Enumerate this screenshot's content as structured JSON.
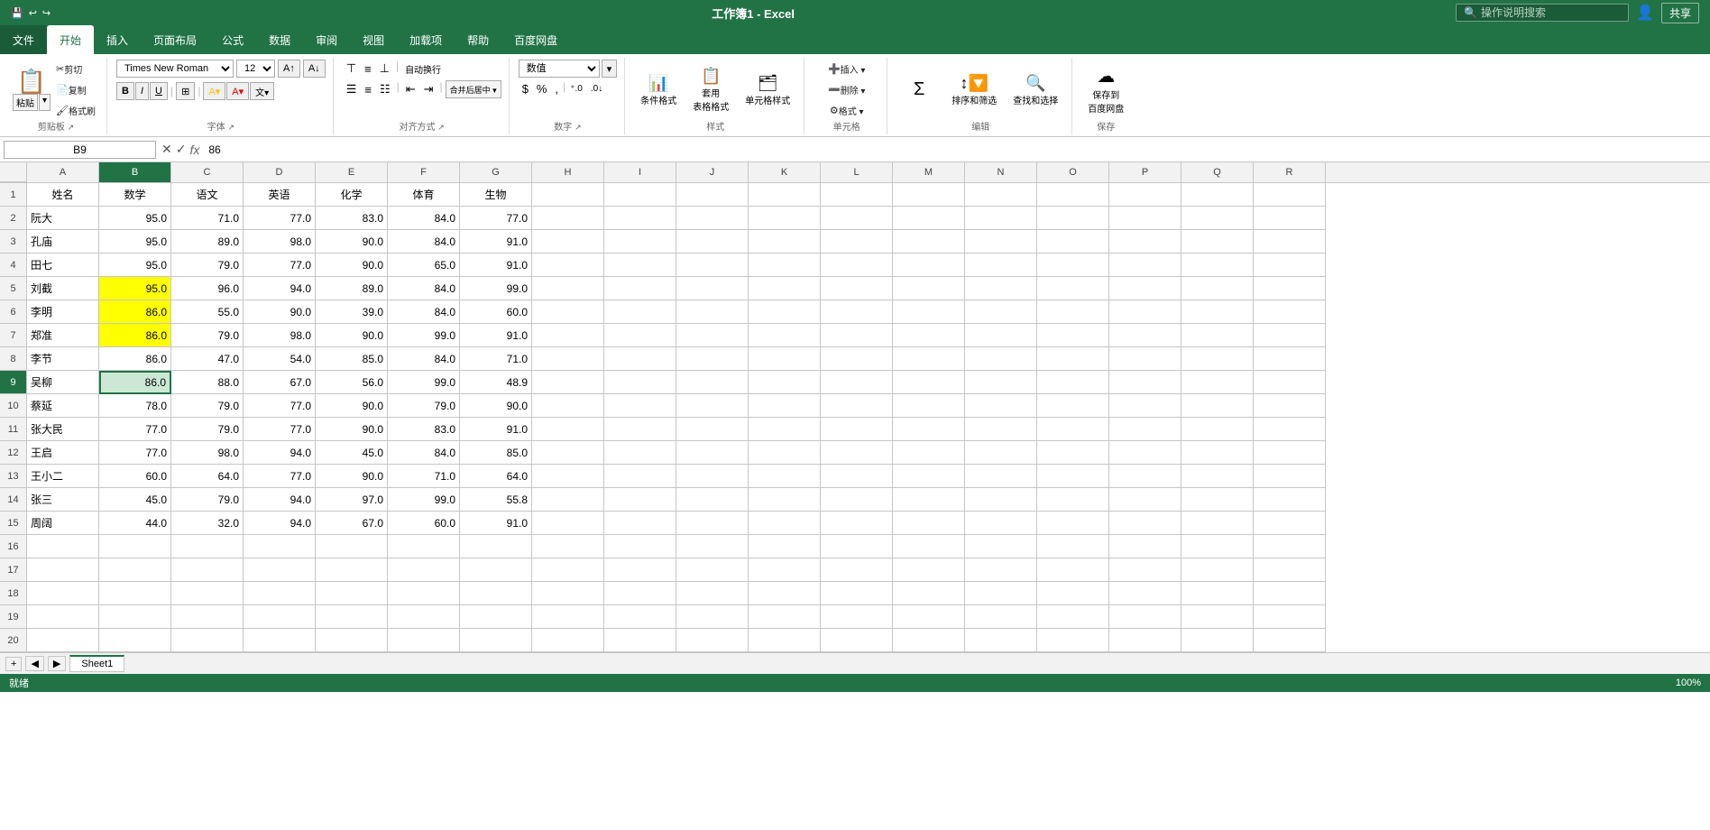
{
  "titleBar": {
    "filename": "工作簿1 - Excel",
    "shareBtn": "共享",
    "userIcon": "👤"
  },
  "ribbon": {
    "tabs": [
      "文件",
      "开始",
      "插入",
      "页面布局",
      "公式",
      "数据",
      "审阅",
      "视图",
      "加载项",
      "帮助",
      "百度网盘"
    ],
    "activeTab": "开始",
    "searchPlaceholder": "操作说明搜索",
    "clipboard": {
      "label": "剪贴板",
      "paste": "粘贴",
      "cut": "✂",
      "copy": "📋",
      "formatPainter": "🖌"
    },
    "font": {
      "label": "字体",
      "fontName": "Times New Roman",
      "fontSize": "12",
      "boldLabel": "B",
      "italicLabel": "I",
      "underlineLabel": "U",
      "increaseFontLabel": "A↑",
      "decreaseFontLabel": "A↓",
      "borderLabel": "⊞",
      "fillLabel": "🎨",
      "fontColorLabel": "A"
    },
    "alignment": {
      "label": "对齐方式",
      "alignTop": "⊤",
      "alignMiddle": "≡",
      "alignBottom": "⊥",
      "alignLeft": "≡",
      "alignCenter": "≡",
      "alignRight": "≡",
      "indent": "⇤",
      "outdent": "⇥",
      "wrapText": "自动换行",
      "mergeCenter": "合并后居中"
    },
    "number": {
      "label": "数字",
      "format": "数值",
      "percent": "%",
      "comma": ",",
      "currency": "$",
      "increaseDecimal": ".0↑",
      "decreaseDecimal": ".0↓"
    },
    "styles": {
      "label": "样式",
      "conditional": "条件格式",
      "tableStyle": "套用\n表格格式",
      "cellStyle": "单元格样式"
    },
    "cells": {
      "label": "单元格",
      "insert": "插入",
      "delete": "删除",
      "format": "格式"
    },
    "editing": {
      "label": "编辑",
      "sum": "Σ",
      "sortFilter": "排序和筛选",
      "findSelect": "查找和选择"
    },
    "save": {
      "label": "保存到\n百度网盘"
    }
  },
  "formulaBar": {
    "cellRef": "B9",
    "formula": "86",
    "cancelBtn": "✕",
    "confirmBtn": "✓",
    "fxBtn": "fx"
  },
  "spreadsheet": {
    "columns": [
      "A",
      "B",
      "C",
      "D",
      "E",
      "F",
      "G",
      "H",
      "I",
      "J",
      "K",
      "L",
      "M",
      "N",
      "O",
      "P",
      "Q",
      "R"
    ],
    "selectedCell": "B9",
    "headers": [
      "姓名",
      "数学",
      "语文",
      "英语",
      "化学",
      "体育",
      "生物"
    ],
    "rows": [
      {
        "num": 1,
        "cells": [
          "姓名",
          "数学",
          "语文",
          "英语",
          "化学",
          "体育",
          "生物",
          "",
          "",
          "",
          "",
          "",
          "",
          "",
          "",
          "",
          "",
          ""
        ]
      },
      {
        "num": 2,
        "cells": [
          "阮大",
          "95.0",
          "71.0",
          "77.0",
          "83.0",
          "84.0",
          "77.0",
          "",
          "",
          "",
          "",
          "",
          "",
          "",
          "",
          "",
          "",
          ""
        ]
      },
      {
        "num": 3,
        "cells": [
          "孔庙",
          "95.0",
          "89.0",
          "98.0",
          "90.0",
          "84.0",
          "91.0",
          "",
          "",
          "",
          "",
          "",
          "",
          "",
          "",
          "",
          "",
          ""
        ]
      },
      {
        "num": 4,
        "cells": [
          "田七",
          "95.0",
          "79.0",
          "77.0",
          "90.0",
          "65.0",
          "91.0",
          "",
          "",
          "",
          "",
          "",
          "",
          "",
          "",
          "",
          "",
          ""
        ]
      },
      {
        "num": 5,
        "cells": [
          "刘截",
          "95.0",
          "96.0",
          "94.0",
          "89.0",
          "84.0",
          "99.0",
          "",
          "",
          "",
          "",
          "",
          "",
          "",
          "",
          "",
          "",
          ""
        ]
      },
      {
        "num": 6,
        "cells": [
          "李明",
          "86.0",
          "55.0",
          "90.0",
          "39.0",
          "84.0",
          "60.0",
          "",
          "",
          "",
          "",
          "",
          "",
          "",
          "",
          "",
          "",
          ""
        ]
      },
      {
        "num": 7,
        "cells": [
          "郑准",
          "86.0",
          "79.0",
          "98.0",
          "90.0",
          "99.0",
          "91.0",
          "",
          "",
          "",
          "",
          "",
          "",
          "",
          "",
          "",
          "",
          ""
        ]
      },
      {
        "num": 8,
        "cells": [
          "李节",
          "86.0",
          "47.0",
          "54.0",
          "85.0",
          "84.0",
          "71.0",
          "",
          "",
          "",
          "",
          "",
          "",
          "",
          "",
          "",
          "",
          ""
        ]
      },
      {
        "num": 9,
        "cells": [
          "吴柳",
          "86.0",
          "88.0",
          "67.0",
          "56.0",
          "99.0",
          "48.9",
          "",
          "",
          "",
          "",
          "",
          "",
          "",
          "",
          "",
          "",
          ""
        ]
      },
      {
        "num": 10,
        "cells": [
          "蔡延",
          "78.0",
          "79.0",
          "77.0",
          "90.0",
          "79.0",
          "90.0",
          "",
          "",
          "",
          "",
          "",
          "",
          "",
          "",
          "",
          "",
          ""
        ]
      },
      {
        "num": 11,
        "cells": [
          "张大民",
          "77.0",
          "79.0",
          "77.0",
          "90.0",
          "83.0",
          "91.0",
          "",
          "",
          "",
          "",
          "",
          "",
          "",
          "",
          "",
          "",
          ""
        ]
      },
      {
        "num": 12,
        "cells": [
          "王启",
          "77.0",
          "98.0",
          "94.0",
          "45.0",
          "84.0",
          "85.0",
          "",
          "",
          "",
          "",
          "",
          "",
          "",
          "",
          "",
          "",
          ""
        ]
      },
      {
        "num": 13,
        "cells": [
          "王小二",
          "60.0",
          "64.0",
          "77.0",
          "90.0",
          "71.0",
          "64.0",
          "",
          "",
          "",
          "",
          "",
          "",
          "",
          "",
          "",
          "",
          ""
        ]
      },
      {
        "num": 14,
        "cells": [
          "张三",
          "45.0",
          "79.0",
          "94.0",
          "97.0",
          "99.0",
          "55.8",
          "",
          "",
          "",
          "",
          "",
          "",
          "",
          "",
          "",
          "",
          ""
        ]
      },
      {
        "num": 15,
        "cells": [
          "周阔",
          "44.0",
          "32.0",
          "94.0",
          "67.0",
          "60.0",
          "91.0",
          "",
          "",
          "",
          "",
          "",
          "",
          "",
          "",
          "",
          "",
          ""
        ]
      },
      {
        "num": 16,
        "cells": [
          "",
          "",
          "",
          "",
          "",
          "",
          "",
          "",
          "",
          "",
          "",
          "",
          "",
          "",
          "",
          "",
          "",
          ""
        ]
      },
      {
        "num": 17,
        "cells": [
          "",
          "",
          "",
          "",
          "",
          "",
          "",
          "",
          "",
          "",
          "",
          "",
          "",
          "",
          "",
          "",
          "",
          ""
        ]
      },
      {
        "num": 18,
        "cells": [
          "",
          "",
          "",
          "",
          "",
          "",
          "",
          "",
          "",
          "",
          "",
          "",
          "",
          "",
          "",
          "",
          "",
          ""
        ]
      },
      {
        "num": 19,
        "cells": [
          "",
          "",
          "",
          "",
          "",
          "",
          "",
          "",
          "",
          "",
          "",
          "",
          "",
          "",
          "",
          "",
          "",
          ""
        ]
      },
      {
        "num": 20,
        "cells": [
          "",
          "",
          "",
          "",
          "",
          "",
          "",
          "",
          "",
          "",
          "",
          "",
          "",
          "",
          "",
          "",
          "",
          ""
        ]
      }
    ]
  },
  "bottomBar": {
    "sheetName": "Sheet1",
    "statusItems": [
      "就绪"
    ],
    "zoomLabel": "100%"
  }
}
